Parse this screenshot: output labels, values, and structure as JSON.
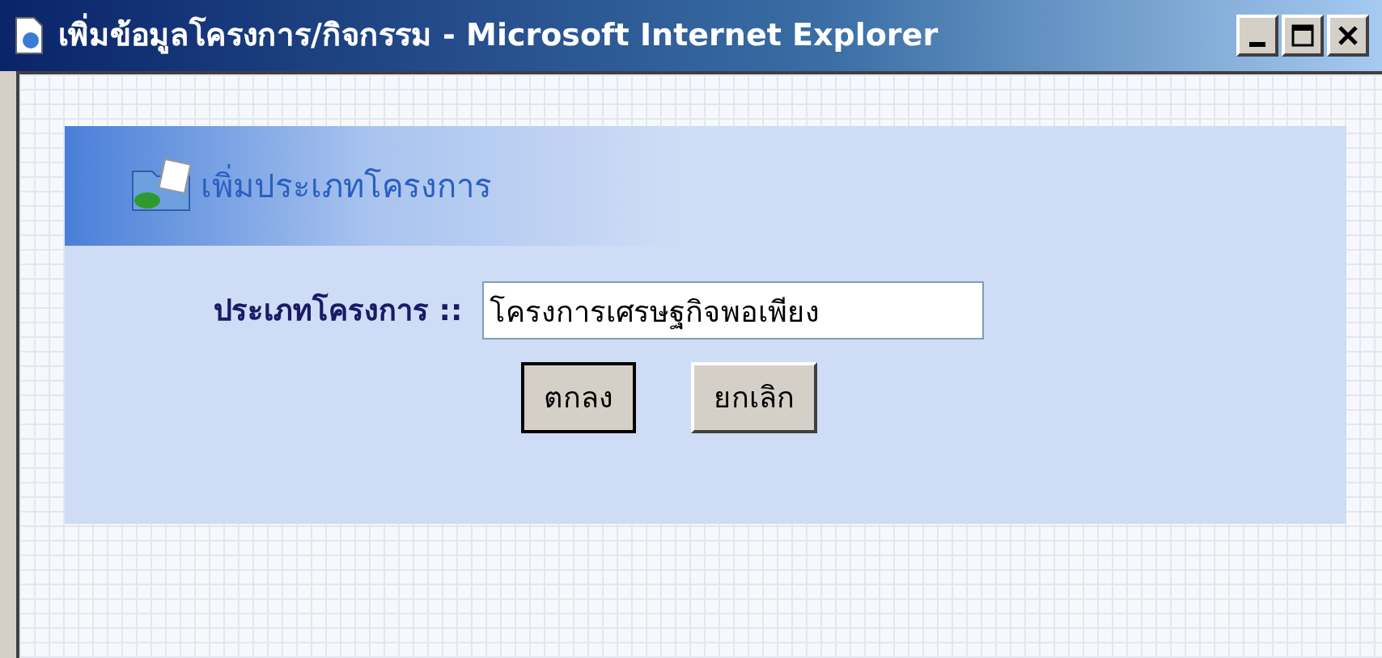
{
  "window": {
    "title": "เพิ่มข้อมูลโครงการ/กิจกรรม - Microsoft Internet Explorer"
  },
  "panel": {
    "heading": "เพิ่มประเภทโครงการ"
  },
  "form": {
    "label": "ประเภทโครงการ ::",
    "value": "โครงการเศรษฐกิจพอเพียง"
  },
  "buttons": [
    {
      "label": "ตกลง",
      "default": true
    },
    {
      "label": "ยกเลิก",
      "default": false
    }
  ]
}
